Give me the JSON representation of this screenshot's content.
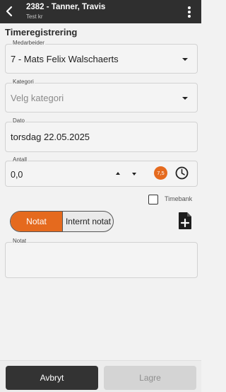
{
  "appbar": {
    "title": "2382 - Tanner, Travis",
    "subtitle": "Test kr"
  },
  "page": {
    "title": "Timeregistrering"
  },
  "fields": {
    "medarbeider": {
      "label": "Medarbeider",
      "value": "7 - Mats Felix Walschaerts"
    },
    "kategori": {
      "label": "Kategori",
      "placeholder": "Velg kategori"
    },
    "dato": {
      "label": "Dato",
      "value": "torsdag 22.05.2025"
    },
    "antall": {
      "label": "Antall",
      "value": "0,0",
      "badge": "7,5"
    },
    "notat": {
      "label": "Notat",
      "value": ""
    }
  },
  "timebank": {
    "label": "Timebank",
    "checked": false
  },
  "note_tabs": [
    {
      "label": "Notat",
      "active": true
    },
    {
      "label": "Internt notat",
      "active": false
    }
  ],
  "buttons": {
    "cancel": "Avbryt",
    "save": "Lagre"
  },
  "icons": [
    "back-arrow-icon",
    "more-vert-icon",
    "clock-icon",
    "note-add-icon"
  ],
  "colors": {
    "accent": "#e56a1e",
    "appbar": "#2f2f2f",
    "cancel_button": "#333333",
    "save_disabled": "#d4d4d4"
  }
}
